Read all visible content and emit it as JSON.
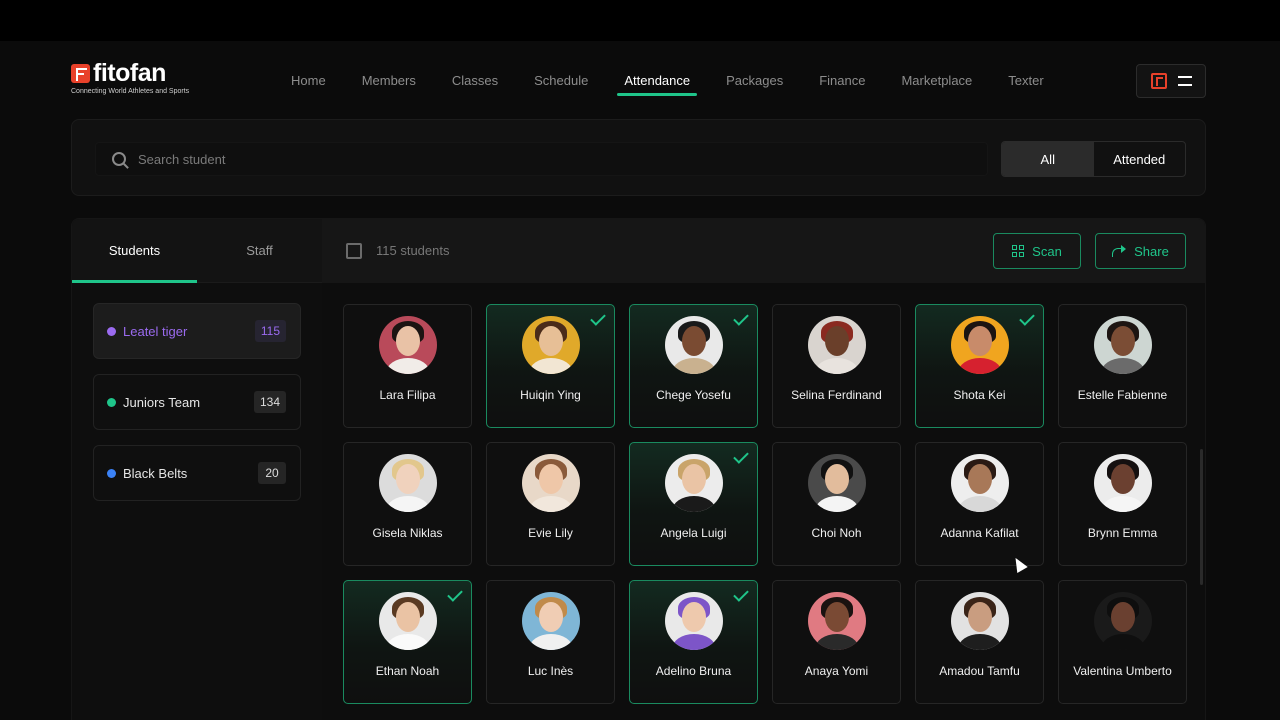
{
  "brand": {
    "name": "fitofan",
    "tagline": "Connecting World Athletes and Sports",
    "accent": "#1fc58a",
    "logo_color": "#e8412a"
  },
  "nav": {
    "items": [
      {
        "label": "Home"
      },
      {
        "label": "Members"
      },
      {
        "label": "Classes"
      },
      {
        "label": "Schedule"
      },
      {
        "label": "Attendance",
        "active": true
      },
      {
        "label": "Packages"
      },
      {
        "label": "Finance"
      },
      {
        "label": "Marketplace"
      },
      {
        "label": "Texter"
      }
    ]
  },
  "header_actions": {
    "logo_icon": "fitofan-mark-icon",
    "menu_icon": "menu-icon"
  },
  "search": {
    "placeholder": "Search student",
    "value": ""
  },
  "filter": {
    "options": [
      "All",
      "Attended"
    ],
    "selected": "All"
  },
  "tabs": [
    {
      "label": "Students",
      "active": true
    },
    {
      "label": "Staff",
      "active": false
    }
  ],
  "groups": [
    {
      "label": "Leatel tiger",
      "count": "115",
      "color": "#9b6bf0",
      "active": true
    },
    {
      "label": "Juniors Team",
      "count": "134",
      "color": "#1fc58a",
      "active": false
    },
    {
      "label": "Black Belts",
      "count": "20",
      "color": "#3b82f6",
      "active": false
    }
  ],
  "toolbar": {
    "count_label": "115 students",
    "scan_label": "Scan",
    "share_label": "Share"
  },
  "students": [
    {
      "name": "Lara Filipa",
      "checked": false,
      "bg": "#b94a5a",
      "skin": "#e9c2a6",
      "hair": "#1b1412",
      "shirt": "#f1ece8"
    },
    {
      "name": "Huiqin Ying",
      "checked": true,
      "bg": "#e0a92a",
      "skin": "#e7bf96",
      "hair": "#4a2b1a",
      "shirt": "#f2e6d3"
    },
    {
      "name": "Chege Yosefu",
      "checked": true,
      "bg": "#e9e9e9",
      "skin": "#7a4b32",
      "hair": "#1a1a1a",
      "shirt": "#c9b18f"
    },
    {
      "name": "Selina Ferdinand",
      "checked": false,
      "bg": "#d9d4cf",
      "skin": "#6a3f2a",
      "hair": "#8a2a20",
      "shirt": "#e8e3de"
    },
    {
      "name": "Shota Kei",
      "checked": true,
      "bg": "#f0a51f",
      "skin": "#c88b6a",
      "hair": "#1b1412",
      "shirt": "#d6212f"
    },
    {
      "name": "Estelle Fabienne",
      "checked": false,
      "bg": "#cdd6d2",
      "skin": "#7b4d35",
      "hair": "#1d1512",
      "shirt": "#6b6b6b"
    },
    {
      "name": "Gisela Niklas",
      "checked": false,
      "bg": "#dcdcdc",
      "skin": "#f0d2bd",
      "hair": "#e2c78c",
      "shirt": "#f5f5f5"
    },
    {
      "name": "Evie Lily",
      "checked": false,
      "bg": "#e8d8c8",
      "skin": "#efc7a8",
      "hair": "#8a5a3a",
      "shirt": "#f1e7dc"
    },
    {
      "name": "Angela Luigi",
      "checked": true,
      "bg": "#ececec",
      "skin": "#eac4a5",
      "hair": "#c9a46a",
      "shirt": "#1a1a1a"
    },
    {
      "name": "Choi Noh",
      "checked": false,
      "bg": "#4a4a4a",
      "skin": "#e2bc9c",
      "hair": "#111111",
      "shirt": "#f4f4f4"
    },
    {
      "name": "Adanna Kafilat",
      "checked": false,
      "bg": "#eeeeee",
      "skin": "#a87858",
      "hair": "#2a1a14",
      "shirt": "#d8d8d8"
    },
    {
      "name": "Brynn Emma",
      "checked": false,
      "bg": "#ececec",
      "skin": "#6b4030",
      "hair": "#151010",
      "shirt": "#f5f5f5"
    },
    {
      "name": "Ethan Noah",
      "checked": true,
      "bg": "#e9e9e9",
      "skin": "#eac3a4",
      "hair": "#5a3a22",
      "shirt": "#fafafa"
    },
    {
      "name": "Luc Inès",
      "checked": false,
      "bg": "#7fb6d6",
      "skin": "#f0cdb4",
      "hair": "#c08a4a",
      "shirt": "#f0f0f0"
    },
    {
      "name": "Adelino Bruna",
      "checked": true,
      "bg": "#e9e9e9",
      "skin": "#eec9ad",
      "hair": "#7d55c8",
      "shirt": "#7d55c8"
    },
    {
      "name": "Anaya Yomi",
      "checked": false,
      "bg": "#e07a82",
      "skin": "#7a4a34",
      "hair": "#1a1210",
      "shirt": "#2a2a2a"
    },
    {
      "name": "Amadou Tamfu",
      "checked": false,
      "bg": "#e2e2e2",
      "skin": "#c99d80",
      "hair": "#3a2418",
      "shirt": "#1e1e1e"
    },
    {
      "name": "Valentina Umberto",
      "checked": false,
      "bg": "#1a1a1a",
      "skin": "#6a4030",
      "hair": "#0e0e0e",
      "shirt": "#0f0f0f"
    }
  ]
}
